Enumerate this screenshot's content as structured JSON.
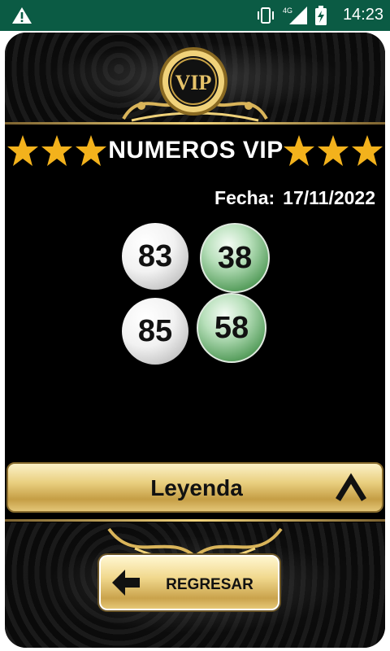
{
  "status_bar": {
    "time": "14:23",
    "network": "4G",
    "icons": [
      "warning-icon",
      "vibrate-icon",
      "signal-icon",
      "battery-charging-icon"
    ]
  },
  "header": {
    "badge_text": "VIP",
    "title": "NUMEROS VIP",
    "stars_each_side": 3
  },
  "draw": {
    "date_label": "Fecha:",
    "date_value": "17/11/2022",
    "numbers": [
      {
        "value": "83",
        "style": "white"
      },
      {
        "value": "38",
        "style": "green"
      },
      {
        "value": "85",
        "style": "white"
      },
      {
        "value": "58",
        "style": "green"
      }
    ]
  },
  "legend_bar": {
    "label": "Leyenda",
    "icon": "chevron-up-icon"
  },
  "back_button": {
    "label": "REGRESAR",
    "icon": "arrow-left-icon"
  },
  "colors": {
    "status_bar": "#0b5b44",
    "gold": "#e9cf7f",
    "star": "#f3b21c",
    "ball_green": "#5aa060"
  }
}
